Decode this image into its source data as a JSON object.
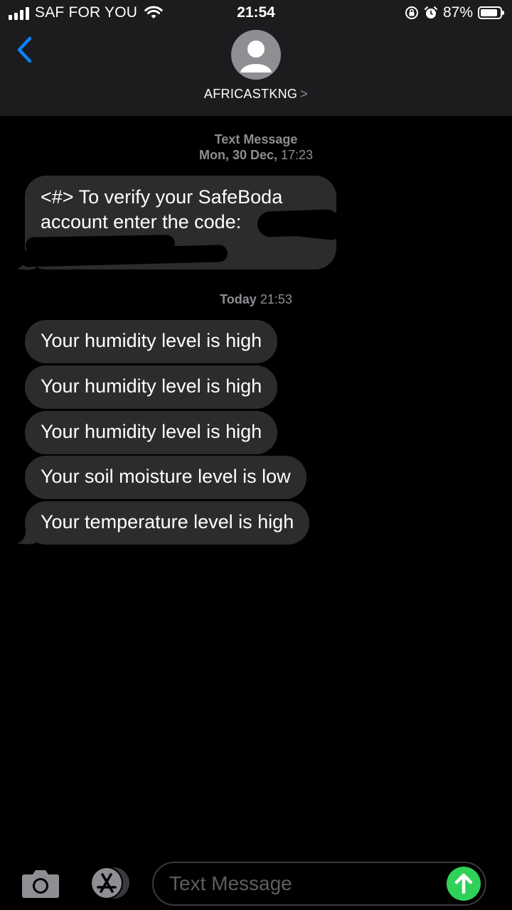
{
  "status_bar": {
    "carrier": "SAF FOR YOU",
    "time": "21:54",
    "battery_percent": "87%",
    "battery_level": 0.87,
    "icons": [
      "signal-icon",
      "wifi-icon",
      "orientation-lock-icon",
      "alarm-icon",
      "battery-icon"
    ]
  },
  "header": {
    "contact_name": "AFRICASTKNG",
    "chevron": ">",
    "icons": [
      "back-chevron-icon",
      "contact-avatar-icon"
    ]
  },
  "thread": {
    "first_group": {
      "type_label": "Text Message",
      "date": "Mon, 30 Dec,",
      "time": "17:23",
      "message": "<#> To verify your SafeBoda account enter the code:"
    },
    "second_group": {
      "day": "Today",
      "time": "21:53",
      "messages": [
        "Your humidity level is high",
        "Your humidity level is high",
        "Your humidity level is high",
        "Your soil moisture level is low",
        "Your temperature level is high"
      ]
    }
  },
  "input_bar": {
    "placeholder": "Text Message",
    "icons": [
      "camera-icon",
      "app-store-icon",
      "send-arrow-icon"
    ]
  },
  "colors": {
    "background": "#000000",
    "bar": "#1c1c1e",
    "bubble": "#2c2c2e",
    "accent_blue": "#0a84ff",
    "send_green": "#30d158",
    "secondary_text": "#8e8e93"
  }
}
